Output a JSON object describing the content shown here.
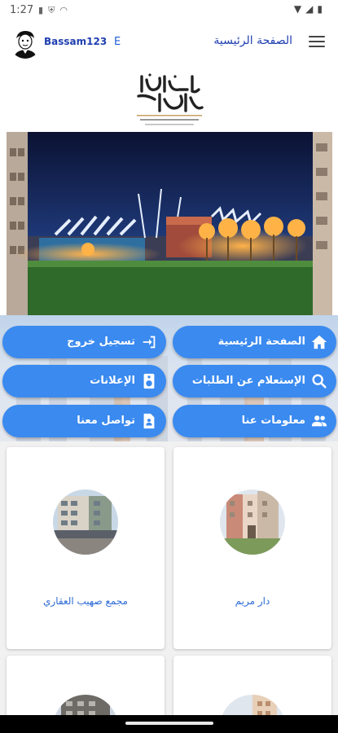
{
  "status": {
    "time": "1:27",
    "left_icons": [
      "sd-card-icon",
      "shield-icon",
      "wifi-off-icon"
    ],
    "right_icons": [
      "wifi-icon",
      "signal-icon",
      "battery-icon"
    ]
  },
  "header": {
    "username": "Bassam123",
    "language_toggle": "E",
    "page_title": "الصفحة الرئيسية"
  },
  "logo": {
    "alt": "الهاشمية العقارية"
  },
  "menu_buttons": [
    {
      "label": "الصفحة الرئيسية",
      "icon": "home-icon"
    },
    {
      "label": "تسجيل خروج",
      "icon": "logout-icon"
    },
    {
      "label": "الإستعلام عن الطلبات",
      "icon": "search-icon"
    },
    {
      "label": "الإعلانات",
      "icon": "speaker-icon"
    },
    {
      "label": "معلومات عنا",
      "icon": "people-icon"
    },
    {
      "label": "تواصل معنا",
      "icon": "contact-form-icon"
    }
  ],
  "properties": [
    {
      "name": "دار مريم"
    },
    {
      "name": "مجمع صهيب العقاري"
    },
    {
      "name": ""
    },
    {
      "name": ""
    }
  ],
  "colors": {
    "accent": "#3a8af0",
    "link": "#2e6bd6",
    "title": "#1f3fb0"
  }
}
